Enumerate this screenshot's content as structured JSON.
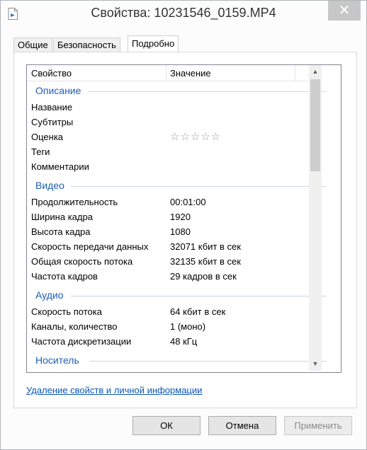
{
  "window": {
    "title": "Свойства: 10231546_0159.MP4",
    "close_glyph": "✕"
  },
  "tabs": [
    {
      "label": "Общие"
    },
    {
      "label": "Безопасность"
    },
    {
      "label": "Подробно",
      "active": true
    }
  ],
  "list": {
    "columns": {
      "property": "Свойство",
      "value": "Значение"
    },
    "sections": {
      "description": {
        "title": "Описание",
        "rows": [
          {
            "name": "Название",
            "value": ""
          },
          {
            "name": "Субтитры",
            "value": ""
          },
          {
            "name": "Оценка",
            "value": "",
            "rating": 0,
            "max_rating": 5
          },
          {
            "name": "Теги",
            "value": ""
          },
          {
            "name": "Комментарии",
            "value": ""
          }
        ]
      },
      "video": {
        "title": "Видео",
        "rows": [
          {
            "name": "Продолжительность",
            "value": "00:01:00"
          },
          {
            "name": "Ширина кадра",
            "value": "1920"
          },
          {
            "name": "Высота кадра",
            "value": "1080"
          },
          {
            "name": "Скорость передачи данных",
            "value": "32071 кбит в сек"
          },
          {
            "name": "Общая скорость потока",
            "value": "32135 кбит в сек"
          },
          {
            "name": "Частота кадров",
            "value": "29 кадров в сек"
          }
        ]
      },
      "audio": {
        "title": "Аудио",
        "rows": [
          {
            "name": "Скорость потока",
            "value": "64 кбит в сек"
          },
          {
            "name": "Каналы, количество",
            "value": "1 (моно)"
          },
          {
            "name": "Частота дискретизации",
            "value": "48 кГц"
          }
        ]
      },
      "media": {
        "title": "Носитель"
      }
    },
    "stars_glyph": "☆☆☆☆☆",
    "scroll_up_glyph": "▲",
    "scroll_down_glyph": "▼"
  },
  "remove_link": "Удаление свойств и личной информации",
  "buttons": {
    "ok": "ОК",
    "cancel": "Отмена",
    "apply": "Применить"
  },
  "colors": {
    "section_title": "#1e5db3",
    "link": "#0b57b4"
  }
}
